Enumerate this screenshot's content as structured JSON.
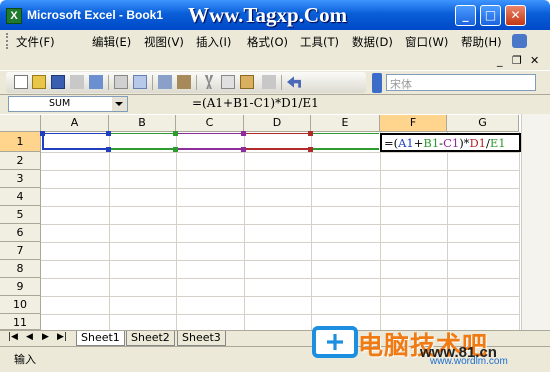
{
  "window": {
    "title": "Microsoft Excel - Book1",
    "watermark": "Www.Tagxp.Com",
    "controls": {
      "minimize": "_",
      "maximize": "□",
      "close": "✕"
    }
  },
  "menu": {
    "items": [
      "文件(F)",
      "编辑(E)",
      "视图(V)",
      "插入(I)",
      "格式(O)",
      "工具(T)",
      "数据(D)",
      "窗口(W)",
      "帮助(H)"
    ],
    "doc_controls": {
      "minimize": "_",
      "restore": "❐",
      "close": "✕"
    }
  },
  "toolbar": {
    "font_name": "宋体"
  },
  "formula_bar": {
    "name_box": "SUM",
    "formula": "=(A1+B1-C1)*D1/E1"
  },
  "sheet": {
    "columns": [
      "A",
      "B",
      "C",
      "D",
      "E",
      "F",
      "G"
    ],
    "rows": [
      "1",
      "2",
      "3",
      "4",
      "5",
      "6",
      "7",
      "8",
      "9",
      "10",
      "11"
    ],
    "active_cell": "F1",
    "edit_cell": {
      "parts": [
        {
          "text": "=(",
          "color": "#000000"
        },
        {
          "text": "A1",
          "color": "#1f3fbf"
        },
        {
          "text": "+",
          "color": "#000000"
        },
        {
          "text": "B1",
          "color": "#2e9b2e"
        },
        {
          "text": "-",
          "color": "#000000"
        },
        {
          "text": "C1",
          "color": "#8e2c9c"
        },
        {
          "text": ")*",
          "color": "#000000"
        },
        {
          "text": "D1",
          "color": "#b02a2a"
        },
        {
          "text": "/",
          "color": "#000000"
        },
        {
          "text": "E1",
          "color": "#2e9b2e"
        }
      ]
    },
    "reference_colors": {
      "A1": "#1f3fbf",
      "B1": "#2e9b2e",
      "C1": "#8e2c9c",
      "D1": "#b02a2a",
      "E1": "#2e9b2e"
    }
  },
  "tabs": {
    "nav": [
      "|◀",
      "◀",
      "▶",
      "▶|"
    ],
    "sheets": [
      "Sheet1",
      "Sheet2",
      "Sheet3"
    ],
    "active": "Sheet1"
  },
  "status": {
    "mode": "输入"
  },
  "watermark_bottom": {
    "logo_text": "电脑技术吧",
    "url_main": "www.81.cn",
    "url_small": "www.wordlm.com"
  }
}
